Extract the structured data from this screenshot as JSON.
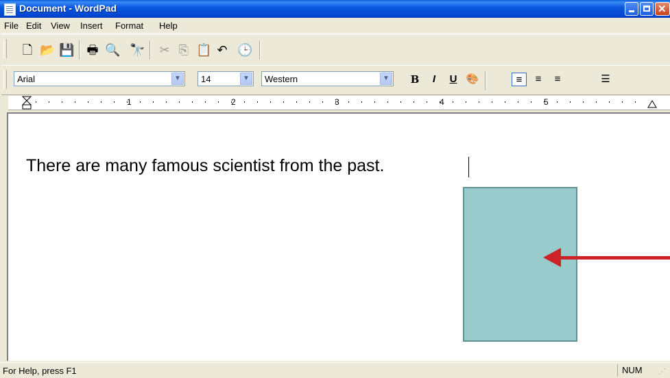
{
  "window": {
    "title": "Document - WordPad"
  },
  "menu": [
    "File",
    "Edit",
    "View",
    "Insert",
    "Format",
    "Help"
  ],
  "toolbar_icons": [
    "new-document-icon",
    "open-folder-icon",
    "save-icon",
    "print-icon",
    "print-preview-icon",
    "find-icon",
    "cut-icon",
    "copy-icon",
    "paste-icon",
    "undo-icon",
    "insert-datetime-icon"
  ],
  "format_bar": {
    "font": "Arial",
    "size": "14",
    "script": "Western",
    "bold": "B",
    "italic": "I",
    "underline": "U"
  },
  "ruler": {
    "numbers": [
      "1",
      "2",
      "3",
      "4",
      "5"
    ]
  },
  "document": {
    "text": "There are many famous scientist from the past."
  },
  "colors": {
    "shape_fill": "#99cbcd",
    "arrow": "#cc2329",
    "titlebar": "#0b58e0"
  },
  "status": {
    "help": "For Help, press F1",
    "num": "NUM"
  }
}
